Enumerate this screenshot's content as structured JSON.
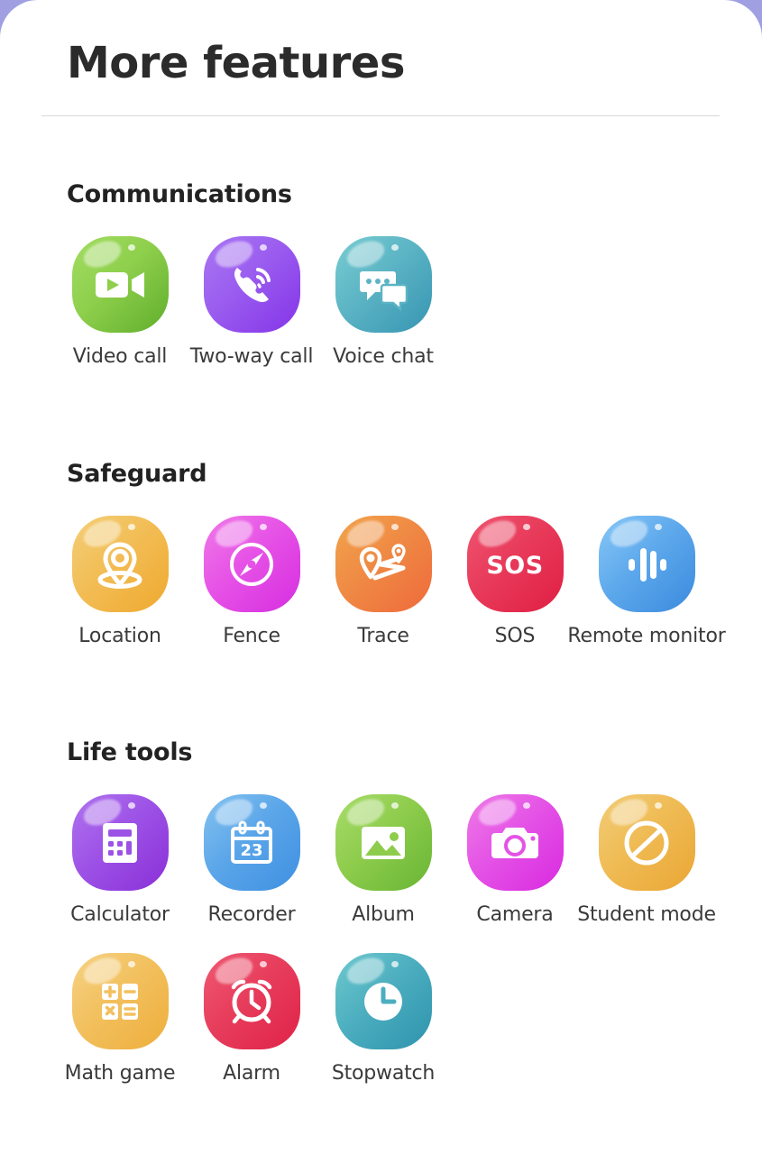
{
  "window": {
    "backdrop_color": "#9f9fe2",
    "sheet_color": "#ffffff"
  },
  "header": {
    "title": "More features"
  },
  "sections": [
    {
      "id": "communications",
      "title": "Communications",
      "items": [
        {
          "label": "Video call",
          "icon": "video-camera-icon",
          "color_start": "#a3dd63",
          "color_end": "#5fae2c"
        },
        {
          "label": "Two-way call",
          "icon": "phone-call-icon",
          "color_start": "#a977f2",
          "color_end": "#8534e8"
        },
        {
          "label": "Voice chat",
          "icon": "chat-bubbles-icon",
          "color_start": "#79cdd2",
          "color_end": "#3795b3"
        }
      ]
    },
    {
      "id": "safeguard",
      "title": "Safeguard",
      "items": [
        {
          "label": "Location",
          "icon": "map-pin-icon",
          "color_start": "#f3cf78",
          "color_end": "#efa92f"
        },
        {
          "label": "Fence",
          "icon": "compass-icon",
          "color_start": "#f07ae8",
          "color_end": "#d62ee0"
        },
        {
          "label": "Trace",
          "icon": "route-trace-icon",
          "color_start": "#f3a košt",
          "color_start2": "#f2a44c",
          "color_end": "#ef6a3c"
        },
        {
          "label": "SOS",
          "icon": "sos-icon",
          "color_start": "#ef5570",
          "color_end": "#e01f43"
        },
        {
          "label": "Remote monitor",
          "icon": "waveform-icon",
          "color_start": "#88c7f7",
          "color_end": "#3a8ade"
        }
      ]
    },
    {
      "id": "life-tools",
      "title": "Life tools",
      "items": [
        {
          "label": "Calculator",
          "icon": "calculator-icon",
          "color_start": "#b074ef",
          "color_end": "#8a2fd8"
        },
        {
          "label": "Recorder",
          "icon": "calendar-23-icon",
          "color_start": "#86c3f0",
          "color_end": "#3f90e2"
        },
        {
          "label": "Album",
          "icon": "photo-image-icon",
          "color_start": "#a8dd6c",
          "color_end": "#68b534"
        },
        {
          "label": "Camera",
          "icon": "camera-icon",
          "color_start": "#ef7ae6",
          "color_end": "#d92ae0"
        },
        {
          "label": "Student mode",
          "icon": "no-entry-icon",
          "color_start": "#f2cd78",
          "color_end": "#eaa634"
        },
        {
          "label": "Math game",
          "icon": "math-operators-icon",
          "color_start": "#f6d284",
          "color_end": "#eeae3c"
        },
        {
          "label": "Alarm",
          "icon": "alarm-clock-icon",
          "color_start": "#ef5a72",
          "color_end": "#e02348"
        },
        {
          "label": "Stopwatch",
          "icon": "clock-icon",
          "color_start": "#6fc9ce",
          "color_end": "#2e93ad"
        }
      ]
    }
  ],
  "icon_glyph_text": {
    "sos": "SOS",
    "calendar_day": "23",
    "math_plus": "+",
    "math_minus": "−",
    "math_times": "×",
    "math_equals": "="
  }
}
